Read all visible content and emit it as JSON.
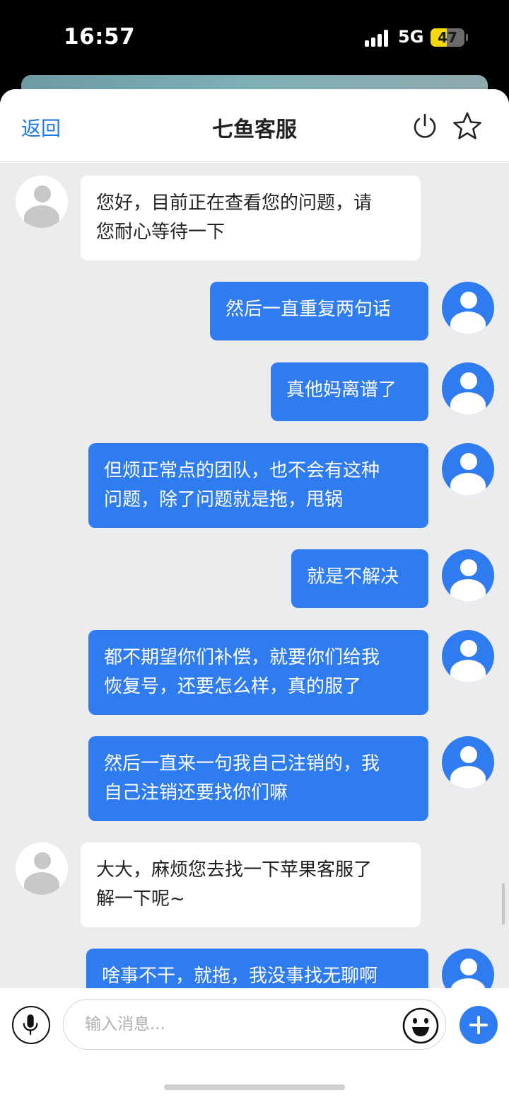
{
  "status_bar": {
    "time": "16:57",
    "network": "5G",
    "battery": "47"
  },
  "header": {
    "back_label": "返回",
    "title": "七鱼客服",
    "power_icon": "power-icon",
    "favorite_icon": "star-icon"
  },
  "messages": [
    {
      "sender": "agent",
      "lines": [
        "您好，目前正在查看您的问题，请",
        "您耐心等待一下"
      ]
    },
    {
      "sender": "user",
      "lines": [
        "然后一直重复两句话"
      ]
    },
    {
      "sender": "user",
      "lines": [
        "真他妈离谱了"
      ]
    },
    {
      "sender": "user",
      "lines": [
        "但烦正常点的团队，也不会有这种",
        "问题，除了问题就是拖，甩锅"
      ]
    },
    {
      "sender": "user",
      "lines": [
        "就是不解决"
      ]
    },
    {
      "sender": "user",
      "lines": [
        "都不期望你们补偿，就要你们给我",
        "恢复号，还要怎么样，真的服了"
      ]
    },
    {
      "sender": "user",
      "lines": [
        "然后一直来一句我自己注销的，我",
        "自己注销还要找你们嘛"
      ]
    },
    {
      "sender": "agent",
      "lines": [
        "大大，麻烦您去找一下苹果客服了",
        "解一下呢~"
      ]
    },
    {
      "sender": "user",
      "lines": [
        "啥事不干，就拖，我没事找无聊啊"
      ]
    }
  ],
  "input_bar": {
    "placeholder": "输入消息...",
    "value": "",
    "mic_icon": "microphone-icon",
    "emoji_icon": "emoji-icon",
    "add_icon": "plus-icon"
  },
  "colors": {
    "accent": "#2f7bf0",
    "link": "#1f7ae8",
    "chat_bg": "#ececef"
  }
}
